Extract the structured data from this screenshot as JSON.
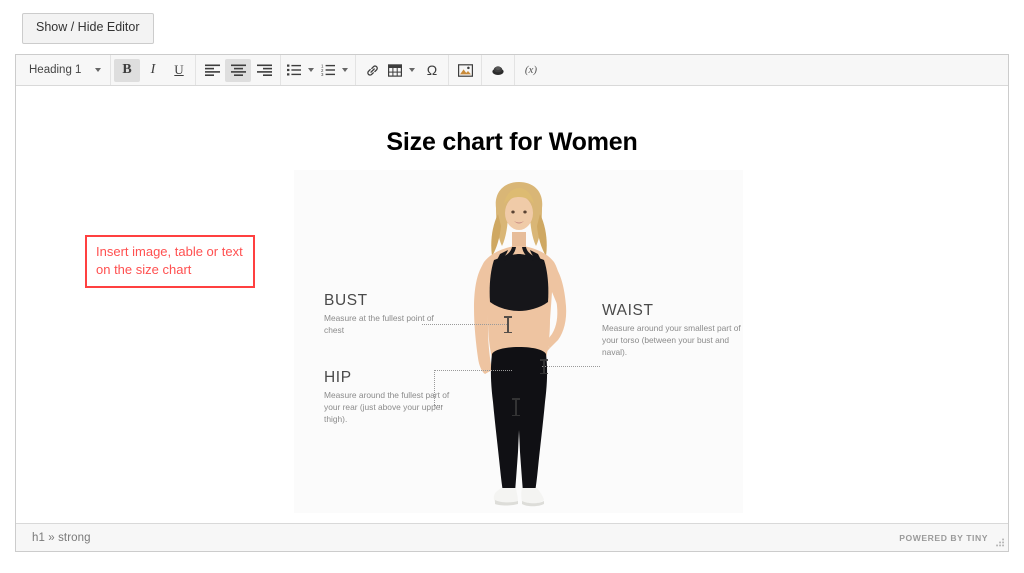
{
  "toggle": {
    "label": "Show / Hide Editor"
  },
  "toolbar": {
    "format_select": {
      "value": "Heading 1",
      "caret": "chevron-down-icon"
    },
    "bold": {
      "label": "B",
      "active": true
    },
    "italic": {
      "label": "I",
      "active": false
    },
    "underline": {
      "label": "U",
      "active": false
    },
    "align_left": {
      "label": "align-left",
      "active": false
    },
    "align_center": {
      "label": "align-center",
      "active": true
    },
    "align_right": {
      "label": "align-right",
      "active": false
    },
    "bullist": {
      "label": "bullet-list"
    },
    "numlist": {
      "label": "numbered-list"
    },
    "link": {
      "label": "link"
    },
    "table": {
      "label": "table"
    },
    "charmap": {
      "label": "Ω"
    },
    "image": {
      "label": "image"
    },
    "emoticon": {
      "label": "emoticon"
    },
    "variable": {
      "label": "(x)"
    }
  },
  "document": {
    "title": "Size chart for Women",
    "annotation": "Insert image, table or text on the size chart",
    "chart": {
      "bust": {
        "heading": "BUST",
        "description": "Measure at the fullest point of chest"
      },
      "waist": {
        "heading": "WAIST",
        "description": "Measure around your smallest part of your torso (between your bust and naval)."
      },
      "hip": {
        "heading": "HIP",
        "description": "Measure around the fullest part of your rear (just above your upper thigh)."
      }
    }
  },
  "statusbar": {
    "element_path": "h1 » strong",
    "branding": "POWERED BY TINY"
  },
  "colors": {
    "annotation_border": "#ff4040",
    "annotation_text": "#ff5050",
    "toolbar_bg": "#f7f7f7",
    "editor_border": "#cccccc"
  }
}
